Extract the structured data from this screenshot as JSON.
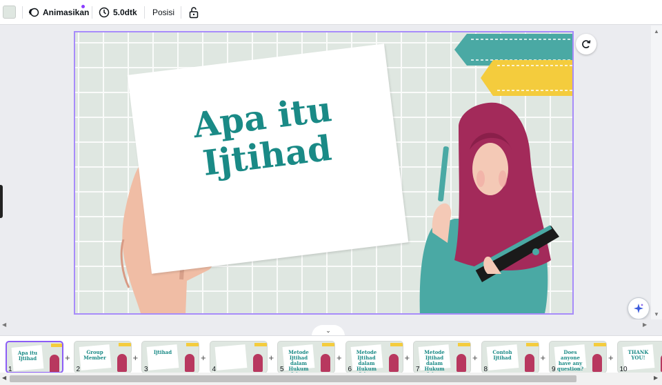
{
  "toolbar": {
    "background_swatch_color": "#dfe7e1",
    "animate_label": "Animasikan",
    "duration_label": "5.0dtk",
    "position_label": "Posisi",
    "lock_icon": "lock-icon"
  },
  "slide": {
    "title_line1": "Apa itu",
    "title_line2": "Ijtihad",
    "accent_teal": "#4aa9a4",
    "accent_yellow": "#f4cc3d",
    "hijab_color": "#a32a5a"
  },
  "pages": [
    {
      "number": "1",
      "title": "Apa itu Ijtihad",
      "selected": true
    },
    {
      "number": "2",
      "title": "Group Member"
    },
    {
      "number": "3",
      "title": "Ijtihad"
    },
    {
      "number": "4",
      "title": ""
    },
    {
      "number": "5",
      "title": "Metode Ijtihad dalam Hukum Islam"
    },
    {
      "number": "6",
      "title": "Metode Ijtihad dalam Hukum Islam"
    },
    {
      "number": "7",
      "title": "Metode Ijtihad dalam Hukum Islam"
    },
    {
      "number": "8",
      "title": "Contoh Ijtihad"
    },
    {
      "number": "9",
      "title": "Does anyone have any question?"
    },
    {
      "number": "10",
      "title": "THANK YOU!"
    }
  ]
}
